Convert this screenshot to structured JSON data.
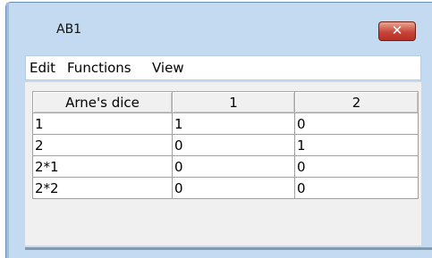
{
  "window": {
    "title": "AB1",
    "close_glyph": "✕"
  },
  "menu": {
    "items": [
      {
        "label": "Edit"
      },
      {
        "label": "Functions"
      },
      {
        "label": "View"
      }
    ]
  },
  "table": {
    "headers": [
      "Arne's dice",
      "1",
      "2"
    ],
    "rows": [
      [
        "1",
        "1",
        "0"
      ],
      [
        "2",
        "0",
        "1"
      ],
      [
        "2*1",
        "0",
        "0"
      ],
      [
        "2*2",
        "0",
        "0"
      ]
    ]
  }
}
